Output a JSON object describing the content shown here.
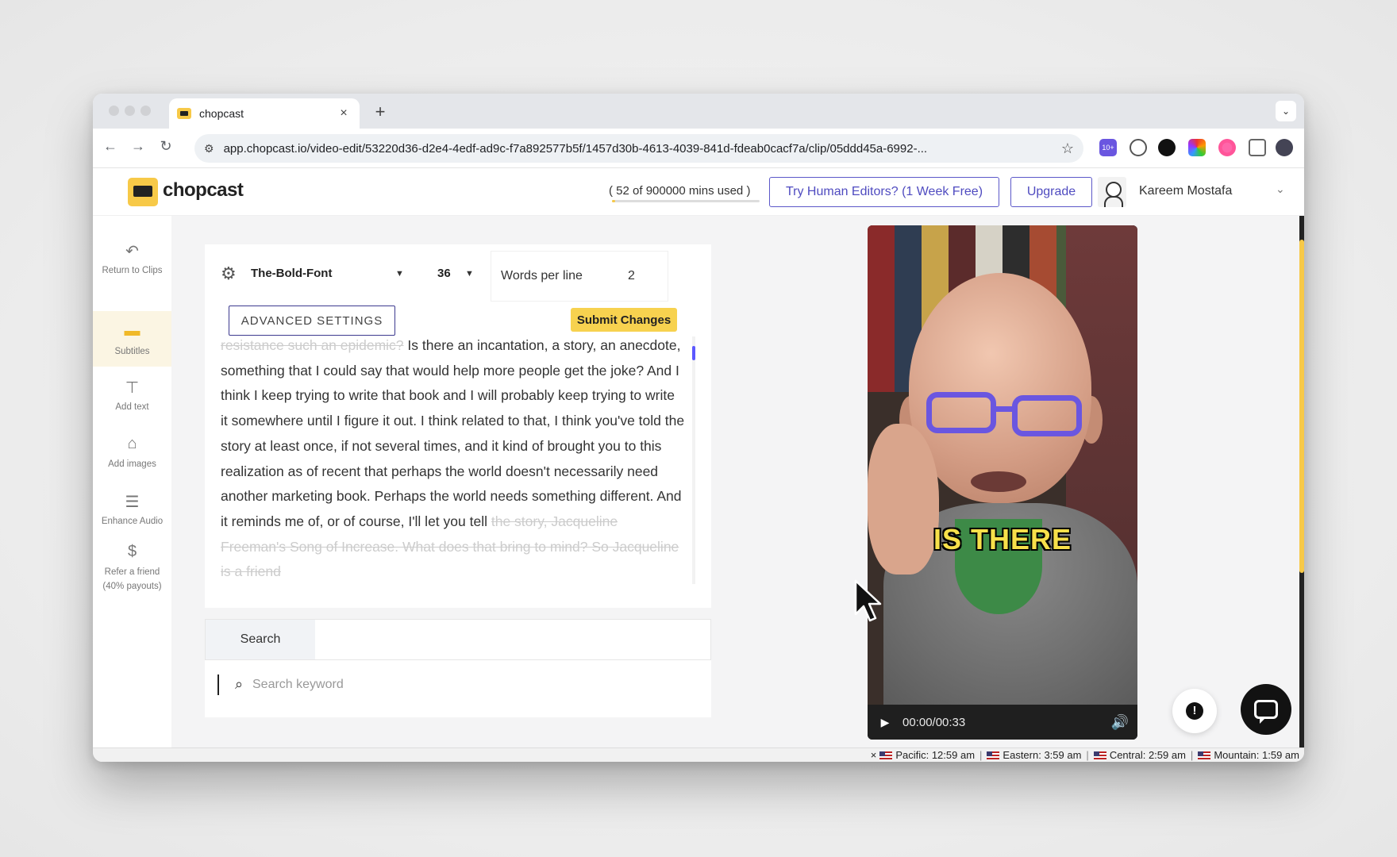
{
  "browser": {
    "tab_title": "chopcast",
    "tab_close": "×",
    "new_tab": "+",
    "url": "app.chopcast.io/video-edit/53220d36-d2e4-4edf-ad9c-f7a892577b5f/1457d30b-4613-4039-841d-fdeab0cacf7a/clip/05ddd45a-6992-...",
    "extension_badge": "10+"
  },
  "header": {
    "logo_text": "chopcast",
    "usage_text": "( 52 of 900000 mins used )",
    "usage_fraction": 6e-05,
    "human_editors_label": "Try Human Editors? (1 Week Free)",
    "upgrade_label": "Upgrade",
    "user_name": "Kareem Mostafa"
  },
  "sidebar": {
    "items": [
      {
        "label": "Return to Clips",
        "icon": "return-icon"
      },
      {
        "label": "Subtitles",
        "icon": "subtitles-icon"
      },
      {
        "label": "Add text",
        "icon": "text-icon"
      },
      {
        "label": "Add images",
        "icon": "camera-icon"
      },
      {
        "label": "Enhance Audio",
        "icon": "sliders-icon"
      },
      {
        "label": "Refer a friend",
        "sublabel": "(40% payouts)",
        "icon": "dollar-icon"
      }
    ]
  },
  "editor": {
    "font_name": "The-Bold-Font",
    "font_size": "36",
    "words_per_line_label": "Words per line",
    "words_per_line_value": "2",
    "advanced_settings_label": "ADVANCED SETTINGS",
    "submit_label": "Submit Changes",
    "transcript_faded_before": "resistance such an epidemic?",
    "transcript_main": "Is there an incantation, a story, an anecdote, something that I could say that would help more people get the joke? And I think I keep trying to write that book and I will probably keep trying to write it somewhere until I figure it out. I think related to that, I think you've told the story at least once, if not several times, and it kind of brought you to this realization as of recent that perhaps the world doesn't necessarily need another marketing book. Perhaps the world needs something different. And it reminds me of, or of course, I'll let you tell",
    "transcript_faded_after": "the story, Jacqueline Freeman's Song of Increase. What does that bring to mind? So Jacqueline is a friend"
  },
  "search": {
    "label": "Search",
    "keyword_placeholder": "Search keyword"
  },
  "video": {
    "caption": "IS THERE",
    "time": "00:00/00:33"
  },
  "widgets": {
    "alert_glyph": "!"
  },
  "statusbar": {
    "close": "×",
    "clocks": [
      {
        "label": "Pacific: 12:59 am"
      },
      {
        "label": "Eastern: 3:59 am"
      },
      {
        "label": "Central: 2:59 am"
      },
      {
        "label": "Mountain: 1:59 am"
      }
    ]
  },
  "colors": {
    "brand_yellow": "#f7c948",
    "accent_purple": "#4f4bc0",
    "submit_yellow": "#f7d24f"
  }
}
